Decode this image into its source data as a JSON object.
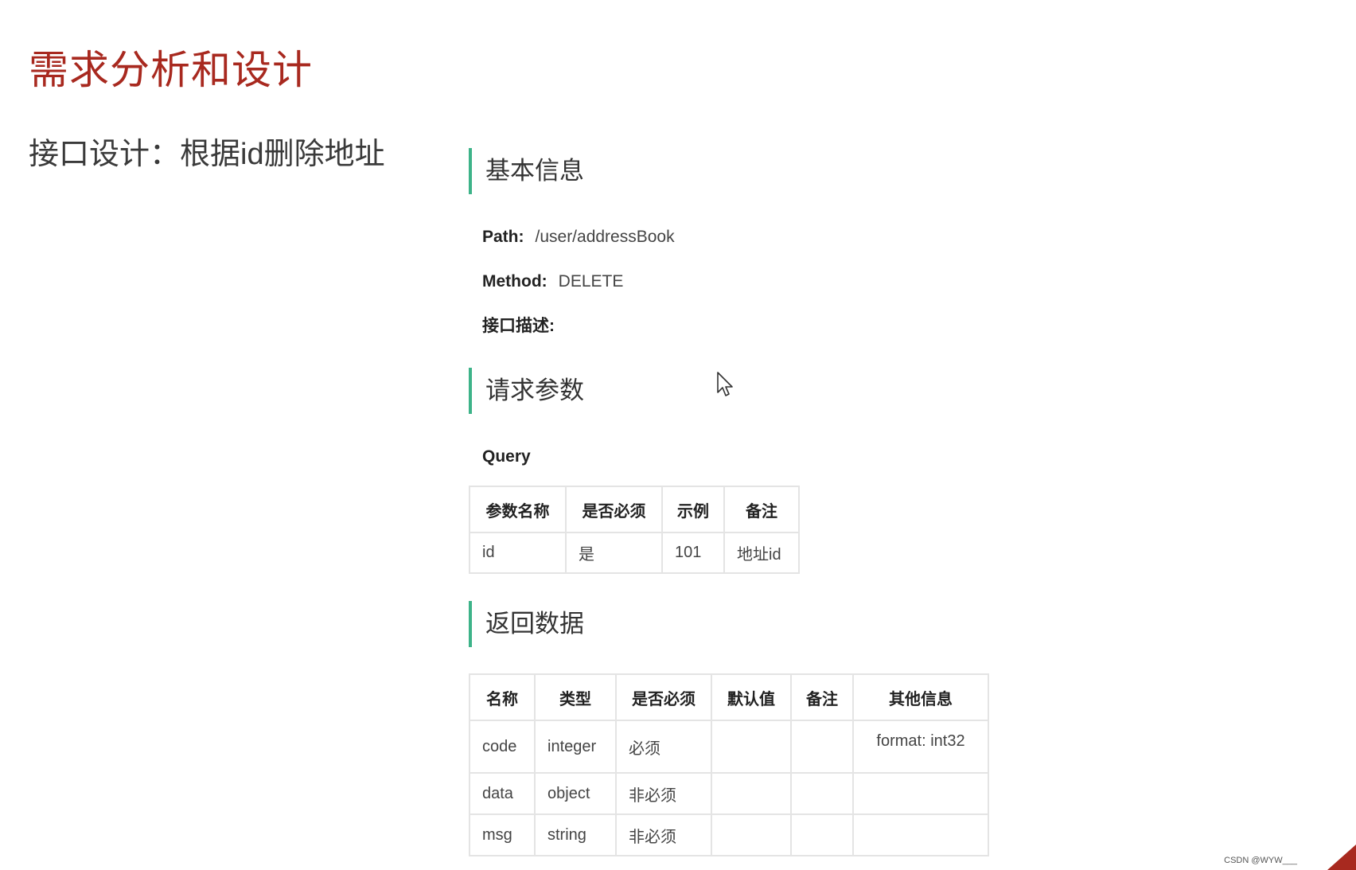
{
  "slide": {
    "title": "需求分析和设计",
    "subtitle": "接口设计：根据id删除地址"
  },
  "basic_info": {
    "heading": "基本信息",
    "path_label": "Path:",
    "path_value": "/user/addressBook",
    "method_label": "Method:",
    "method_value": "DELETE",
    "desc_label": "接口描述:"
  },
  "request": {
    "heading": "请求参数",
    "query_label": "Query",
    "columns": [
      "参数名称",
      "是否必须",
      "示例",
      "备注"
    ],
    "rows": [
      [
        "id",
        "是",
        "101",
        "地址id"
      ]
    ]
  },
  "response": {
    "heading": "返回数据",
    "columns": [
      "名称",
      "类型",
      "是否必须",
      "默认值",
      "备注",
      "其他信息"
    ],
    "rows": [
      [
        "code",
        "integer",
        "必须",
        "",
        "",
        "format: int32"
      ],
      [
        "data",
        "object",
        "非必须",
        "",
        "",
        ""
      ],
      [
        "msg",
        "string",
        "非必须",
        "",
        "",
        ""
      ]
    ]
  },
  "watermark": "CSDN @WYW___",
  "colors": {
    "title": "#a8291f",
    "section_bar": "#3db389",
    "corner": "#a8291f"
  },
  "icons": {
    "cursor": "mouse-pointer-icon"
  }
}
